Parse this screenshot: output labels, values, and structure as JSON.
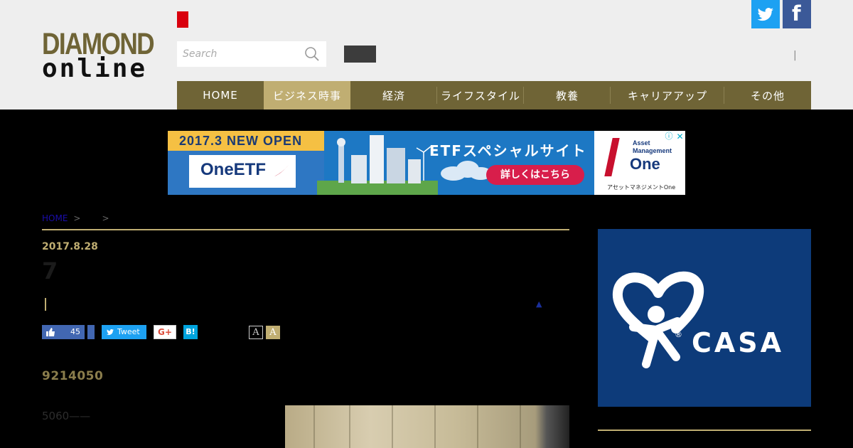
{
  "header": {
    "logo_line1": "DIAMOND",
    "logo_line2": "online",
    "search_placeholder": "Search",
    "social": {
      "twitter_icon": "twitter-bird-icon",
      "facebook_icon": "facebook-f-icon",
      "facebook_glyph": "f"
    },
    "separator": "|"
  },
  "nav": {
    "items": [
      {
        "label": "HOME",
        "active": false
      },
      {
        "label": "ビジネス時事",
        "active": true
      },
      {
        "label": "経済",
        "active": false
      },
      {
        "label": "ライフスタイル",
        "active": false
      },
      {
        "label": "教養",
        "active": false
      },
      {
        "label": "キャリアアップ",
        "active": false
      },
      {
        "label": "その他",
        "active": false
      }
    ]
  },
  "ad": {
    "banner_text": "2017.3 NEW OPEN",
    "etf_label": "OneETF",
    "title": "ETFスペシャルサイト",
    "cta": "詳しくはこちら",
    "brand_line1": "Asset",
    "brand_line2": "Management",
    "brand_name": "One",
    "brand_sub": "アセットマネジメントOne",
    "info_glyph": "ⓘ",
    "close_glyph": "✕"
  },
  "breadcrumb": {
    "home": "HOME",
    "sep": ">"
  },
  "article": {
    "date": "2017.8.28",
    "title": "7",
    "triangle": "▲",
    "like_count": "45",
    "tweet_label": "Tweet",
    "gplus_label": "G+",
    "hatena_label": "B!",
    "font_small": "A",
    "font_large": "A",
    "lead": "9214050",
    "body": "5060——"
  },
  "sidebar": {
    "ad_brand": "CASA",
    "reg_mark": "®"
  },
  "colors": {
    "accent_gold": "#c0ae72",
    "nav_bg": "#6f6436",
    "twitter": "#1da1f2",
    "facebook": "#3b5998",
    "casa_blue": "#0d3b7a"
  }
}
